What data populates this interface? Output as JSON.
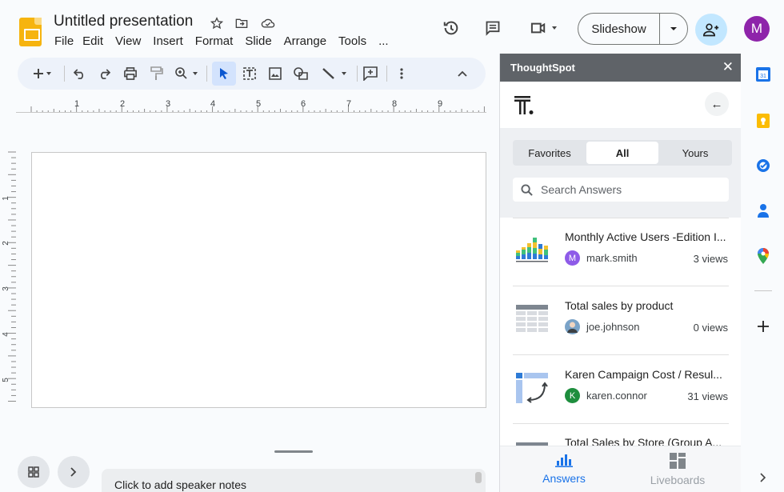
{
  "header": {
    "title": "Untitled presentation",
    "menu": [
      "File",
      "Edit",
      "View",
      "Insert",
      "Format",
      "Slide",
      "Arrange",
      "Tools",
      "..."
    ],
    "slideshow_label": "Slideshow",
    "avatar_initial": "M"
  },
  "ruler": {
    "top_marks": [
      "1",
      "2",
      "3",
      "4",
      "5",
      "6",
      "7",
      "8",
      "9"
    ],
    "left_marks": [
      "1",
      "2",
      "3",
      "4",
      "5"
    ]
  },
  "notes": {
    "placeholder": "Click to add speaker notes"
  },
  "panel": {
    "title": "ThoughtSpot",
    "tabs": [
      "Favorites",
      "All",
      "Yours"
    ],
    "active_tab": "All",
    "search_placeholder": "Search Answers",
    "items": [
      {
        "title": "Monthly Active Users -Edition I...",
        "user_initial": "M",
        "user": "mark.smith",
        "views": "3 views",
        "icon": "bar-chart-icon",
        "user_color": "#8e5be8"
      },
      {
        "title": "Total sales by product",
        "user_initial": "",
        "user": "joe.johnson",
        "views": "0 views",
        "icon": "table-icon",
        "user_color": "#7aa3c8"
      },
      {
        "title": "Karen Campaign Cost / Resul...",
        "user_initial": "K",
        "user": "karen.connor",
        "views": "31 views",
        "icon": "pivot-icon",
        "user_color": "#1e8e3e"
      },
      {
        "title": "Total Sales by Store (Group A...",
        "user_initial": "",
        "user": "",
        "views": "",
        "icon": "table-icon",
        "user_color": ""
      }
    ],
    "nav": {
      "answers": "Answers",
      "liveboards": "Liveboards"
    }
  },
  "colors": {
    "accent": "#0b57d0",
    "panel_header": "#5f6368",
    "share_button": "#c2e7ff",
    "avatar": "#8e24aa",
    "nav_active": "#1a73e8"
  }
}
